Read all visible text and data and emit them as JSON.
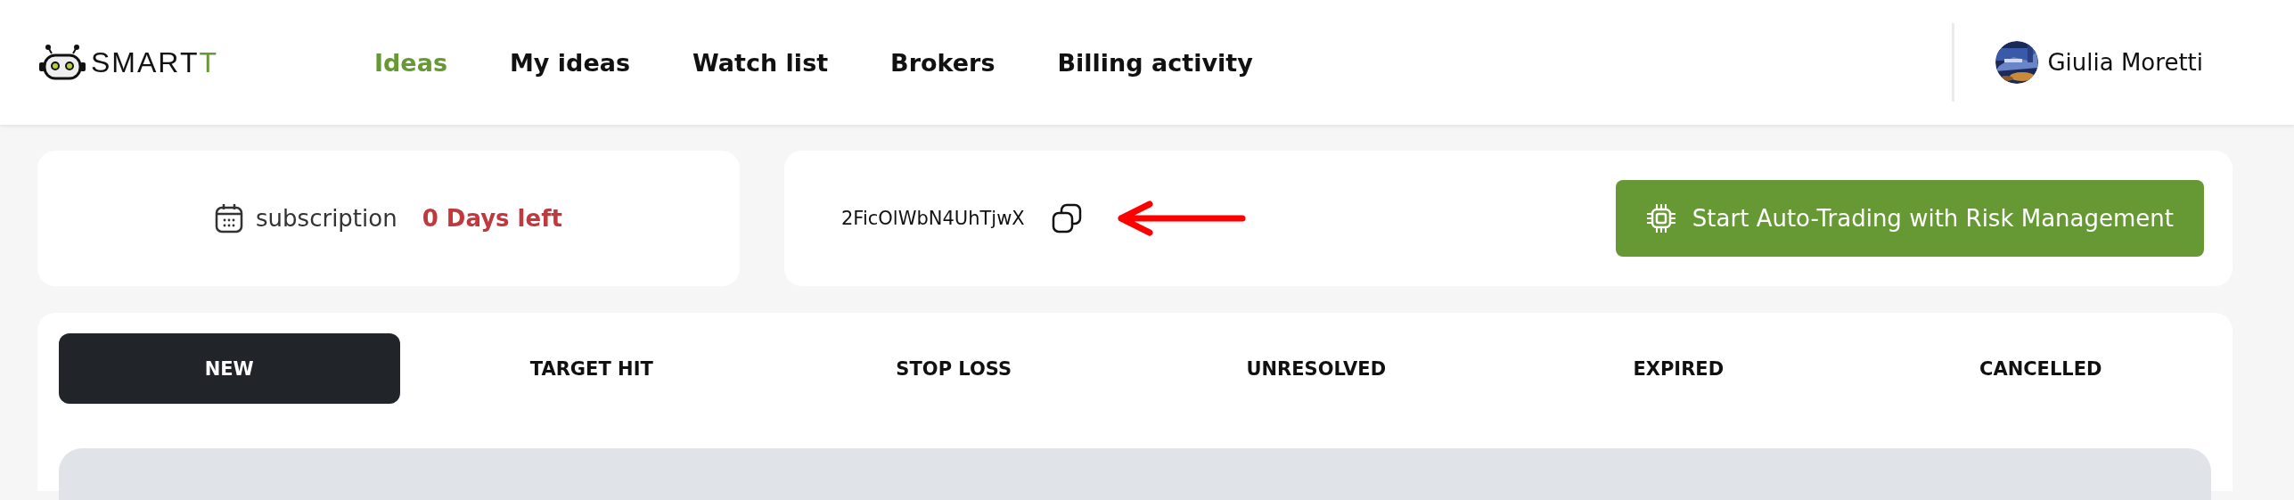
{
  "header": {
    "logo": {
      "text": "SMART",
      "accent": "T"
    },
    "nav": [
      {
        "label": "Ideas",
        "selected": true
      },
      {
        "label": "My ideas",
        "selected": false
      },
      {
        "label": "Watch list",
        "selected": false
      },
      {
        "label": "Brokers",
        "selected": false
      },
      {
        "label": "Billing activity",
        "selected": false
      }
    ],
    "user": {
      "name": "Giulia Moretti"
    }
  },
  "subscription": {
    "label": "subscription",
    "remaining": "0 Days left"
  },
  "key_card": {
    "key": "2FicOlWbN4UhTjwX",
    "button": "Start Auto-Trading with Risk Management"
  },
  "tabs": [
    {
      "label": "NEW",
      "selected": true
    },
    {
      "label": "TARGET HIT",
      "selected": false
    },
    {
      "label": "STOP LOSS",
      "selected": false
    },
    {
      "label": "UNRESOLVED",
      "selected": false
    },
    {
      "label": "EXPIRED",
      "selected": false
    },
    {
      "label": "CANCELLED",
      "selected": false
    }
  ]
}
